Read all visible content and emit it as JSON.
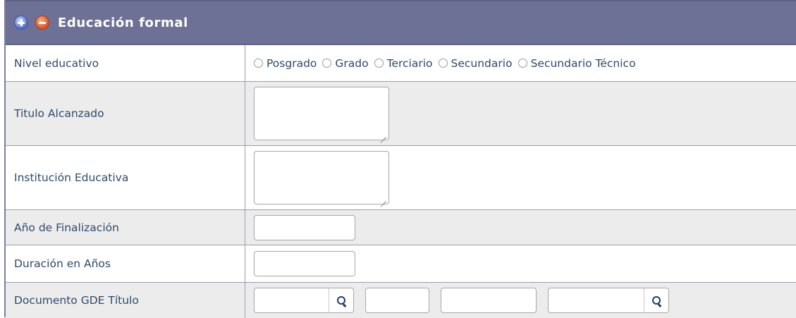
{
  "section": {
    "title": "Educación formal",
    "icons": [
      "plus-icon",
      "minus-icon"
    ]
  },
  "rows": {
    "nivel": {
      "label": "Nivel educativo",
      "options": [
        "Posgrado",
        "Grado",
        "Terciario",
        "Secundario",
        "Secundario Técnico"
      ]
    },
    "titulo": {
      "label": "Titulo Alcanzado",
      "value": ""
    },
    "institucion": {
      "label": "Institución Educativa",
      "value": ""
    },
    "anio": {
      "label": "Año de Finalización",
      "value": ""
    },
    "duracion": {
      "label": "Duración en Años",
      "value": ""
    },
    "documento": {
      "label": "Documento GDE Título",
      "field1": "",
      "field2": "",
      "field3": "",
      "field4": ""
    }
  },
  "colors": {
    "header_bg": "#6e7196",
    "label_text": "#2f4a6b",
    "alt_row_bg": "#ececec"
  }
}
